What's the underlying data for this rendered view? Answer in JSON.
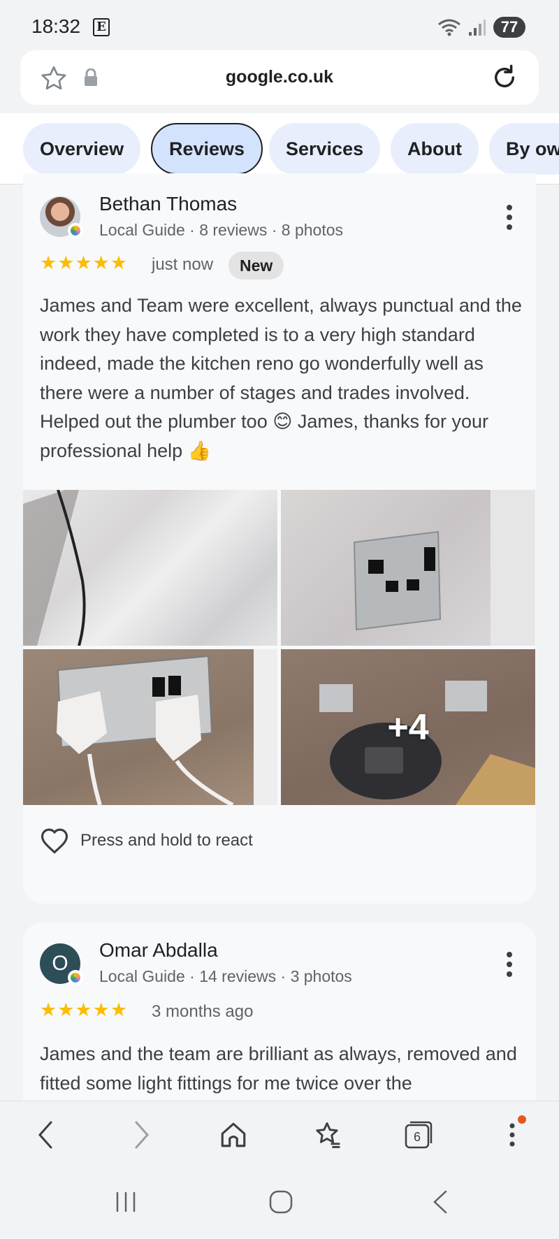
{
  "status_bar": {
    "time": "18:32",
    "e_icon": "E",
    "battery": "77",
    "wifi_icon": "wifi-icon",
    "signal_icon": "signal-icon"
  },
  "browser": {
    "url": "google.co.uk",
    "star_icon": "star-icon",
    "lock_icon": "lock-icon",
    "reload_icon": "reload-icon"
  },
  "tabs": [
    {
      "label": "Overview",
      "active": false
    },
    {
      "label": "Reviews",
      "active": true
    },
    {
      "label": "Services",
      "active": false
    },
    {
      "label": "About",
      "active": false
    },
    {
      "label": "By ow",
      "active": false
    }
  ],
  "reviews": [
    {
      "name": "Bethan Thomas",
      "meta": "Local Guide · 8 reviews · 8 photos",
      "stars": "★★★★★",
      "time": "just now",
      "badge": "New",
      "text": "James and Team were excellent, always punctual and the work they have completed is to a very high standard indeed, made the kitchen reno go wonderfully well as there were a number of stages and trades involved. Helped out the plumber too 😊 James, thanks for your professional help 👍",
      "photos_more": "+4",
      "react_label": "Press and hold to react"
    },
    {
      "name": "Omar Abdalla",
      "avatar_letter": "O",
      "meta": "Local Guide · 14 reviews · 3 photos",
      "stars": "★★★★★",
      "time": "3 months ago",
      "text": "James and the team are brilliant as always, removed and fitted some light fittings for me twice over the"
    }
  ],
  "browser_nav": {
    "tab_count": "6"
  },
  "colors": {
    "star": "#fbbc04",
    "tab_bg": "#e8eefc",
    "tab_active_bg": "#d3e3fd",
    "avatar_teal": "#2d4d57",
    "notif_dot": "#e8561f"
  }
}
